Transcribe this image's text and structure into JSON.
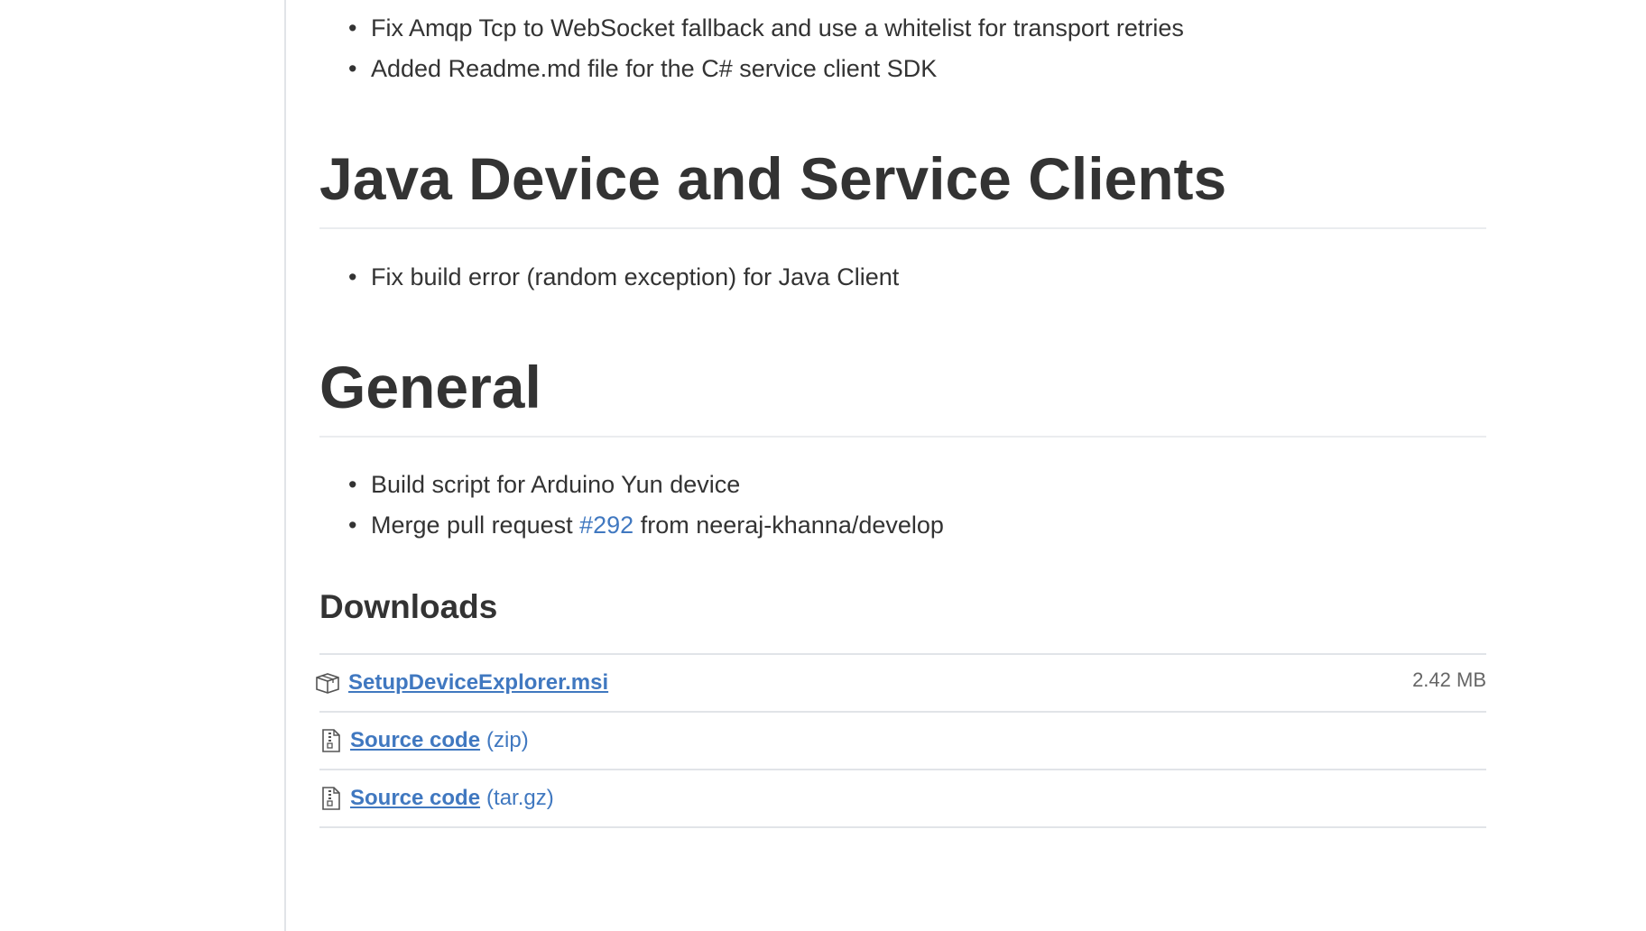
{
  "top_list": {
    "items": [
      "Fix Amqp Tcp to WebSocket fallback and use a whitelist for transport retries",
      "Added Readme.md file for the C# service client SDK"
    ]
  },
  "java_section": {
    "heading": "Java Device and Service Clients",
    "items": [
      "Fix build error (random exception) for Java Client"
    ]
  },
  "general_section": {
    "heading": "General",
    "item1": "Build script for Arduino Yun device",
    "item2_prefix": "Merge pull request ",
    "item2_link": "#292",
    "item2_suffix": " from neeraj-khanna/develop"
  },
  "downloads": {
    "title": "Downloads",
    "files": [
      {
        "name": "SetupDeviceExplorer.msi",
        "ext": "",
        "size": "2.42 MB",
        "icon": "package-icon"
      },
      {
        "name": "Source code",
        "ext": "(zip)",
        "size": "",
        "icon": "file-zip-icon"
      },
      {
        "name": "Source code",
        "ext": "(tar.gz)",
        "size": "",
        "icon": "file-zip-icon"
      }
    ]
  },
  "colors": {
    "link": "#4078c0",
    "text": "#333333",
    "border": "#e1e4e8"
  }
}
